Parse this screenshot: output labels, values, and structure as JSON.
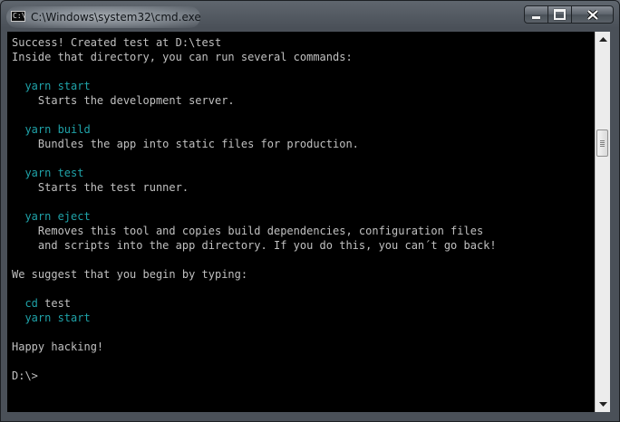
{
  "window": {
    "title": "C:\\Windows\\system32\\cmd.exe",
    "icon": "console-icon",
    "icon_glyph": "C:\\"
  },
  "colors": {
    "background": "#000000",
    "text": "#c0c0c0",
    "command": "#1fa2a8"
  },
  "console": {
    "lines": [
      {
        "text": "Success! Created test at D:\\test",
        "color": "white"
      },
      {
        "text": "Inside that directory, you can run several commands:",
        "color": "white"
      },
      {
        "text": "",
        "color": "white"
      },
      {
        "text": "  yarn start",
        "color": "cyan"
      },
      {
        "text": "    Starts the development server.",
        "color": "white"
      },
      {
        "text": "",
        "color": "white"
      },
      {
        "text": "  yarn build",
        "color": "cyan"
      },
      {
        "text": "    Bundles the app into static files for production.",
        "color": "white"
      },
      {
        "text": "",
        "color": "white"
      },
      {
        "text": "  yarn test",
        "color": "cyan"
      },
      {
        "text": "    Starts the test runner.",
        "color": "white"
      },
      {
        "text": "",
        "color": "white"
      },
      {
        "text": "  yarn eject",
        "color": "cyan"
      },
      {
        "text": "    Removes this tool and copies build dependencies, configuration files",
        "color": "white"
      },
      {
        "text": "    and scripts into the app directory. If you do this, you can´t go back!",
        "color": "white"
      },
      {
        "text": "",
        "color": "white"
      },
      {
        "text": "We suggest that you begin by typing:",
        "color": "white"
      },
      {
        "text": "",
        "color": "white"
      },
      {
        "text": "  cd test",
        "color": "mixed",
        "parts": [
          {
            "text": "  cd",
            "color": "cyan"
          },
          {
            "text": " test",
            "color": "white"
          }
        ]
      },
      {
        "text": "  yarn start",
        "color": "cyan"
      },
      {
        "text": "",
        "color": "white"
      },
      {
        "text": "Happy hacking!",
        "color": "white"
      },
      {
        "text": "",
        "color": "white"
      },
      {
        "text": "D:\\>",
        "color": "white"
      }
    ]
  }
}
